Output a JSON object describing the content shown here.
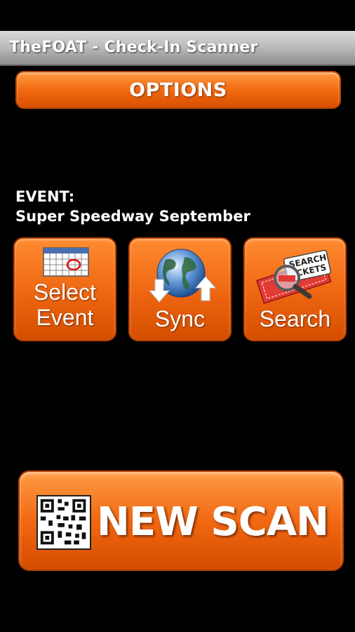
{
  "app": {
    "title": "TheFOAT - Check-In Scanner"
  },
  "options": {
    "label": "OPTIONS"
  },
  "event": {
    "heading": "EVENT:",
    "name": "Super Speedway September"
  },
  "tiles": {
    "select_event": {
      "line1": "Select",
      "line2": "Event",
      "icon": "calendar-icon"
    },
    "sync": {
      "label": "Sync",
      "icon": "globe-sync-icon"
    },
    "search": {
      "label": "Search",
      "icon": "search-tickets-icon",
      "badge_line1": "SEARCH",
      "badge_line2": "CKETS"
    }
  },
  "scan": {
    "label": "NEW SCAN",
    "icon": "qr-code-icon"
  },
  "colors": {
    "accent": "#f26a10",
    "background": "#000000",
    "title_bar": "#bdbdbd"
  }
}
